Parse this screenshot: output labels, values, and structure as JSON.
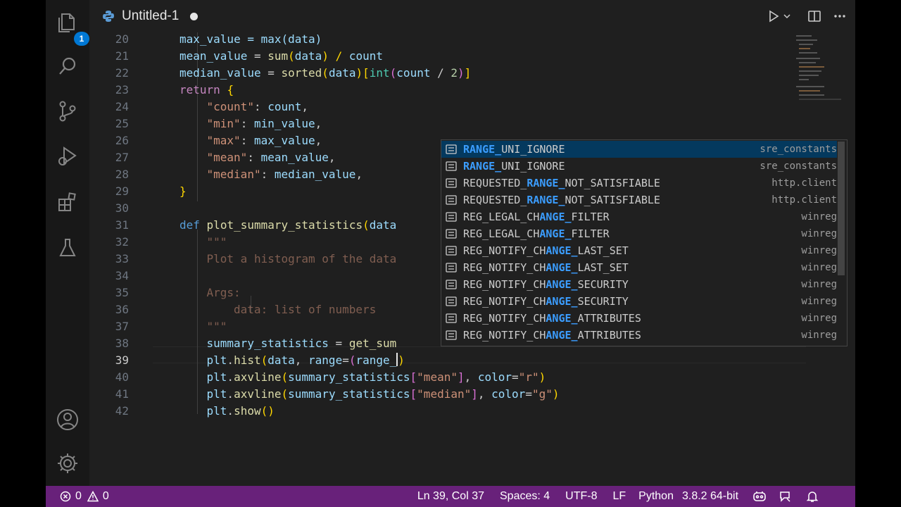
{
  "tab": {
    "filename": "Untitled-1"
  },
  "activity": {
    "explorer_badge": "1"
  },
  "editor": {
    "lines": [
      {
        "num": "20"
      },
      {
        "num": "21"
      },
      {
        "num": "22"
      },
      {
        "num": "23"
      },
      {
        "num": "24"
      },
      {
        "num": "25"
      },
      {
        "num": "26"
      },
      {
        "num": "27"
      },
      {
        "num": "28"
      },
      {
        "num": "29"
      },
      {
        "num": "30"
      },
      {
        "num": "31"
      },
      {
        "num": "32"
      },
      {
        "num": "33"
      },
      {
        "num": "34"
      },
      {
        "num": "35"
      },
      {
        "num": "36"
      },
      {
        "num": "37"
      },
      {
        "num": "38"
      },
      {
        "num": "39"
      },
      {
        "num": "40"
      },
      {
        "num": "41"
      },
      {
        "num": "42"
      }
    ],
    "code": {
      "l20": "max_value = max(data)",
      "l21": [
        "mean_value",
        " = ",
        "sum",
        "(",
        "data",
        ") / ",
        "count"
      ],
      "l22": [
        "median_value",
        " = ",
        "sorted",
        "(",
        "data",
        ")",
        "[",
        "int",
        "(",
        "count",
        " / ",
        "2",
        ")",
        "]"
      ],
      "l23": [
        "return",
        " ",
        "{"
      ],
      "l24": [
        "\"count\"",
        ": ",
        "count",
        ","
      ],
      "l25": [
        "\"min\"",
        ": ",
        "min_value",
        ","
      ],
      "l26": [
        "\"max\"",
        ": ",
        "max_value",
        ","
      ],
      "l27": [
        "\"mean\"",
        ": ",
        "mean_value",
        ","
      ],
      "l28": [
        "\"median\"",
        ": ",
        "median_value",
        ","
      ],
      "l29": [
        "}"
      ],
      "l31": [
        "def",
        " ",
        "plot_summary_statistics",
        "(",
        "data"
      ],
      "l32": [
        "\"\"\""
      ],
      "l33": [
        "Plot a histogram of the data"
      ],
      "l35": [
        "Args:"
      ],
      "l36": [
        "data: list of numbers"
      ],
      "l37": [
        "\"\"\""
      ],
      "l38": [
        "summary_statistics",
        " = ",
        "get_sum"
      ],
      "l39": [
        "plt",
        ".",
        "hist",
        "(",
        "data",
        ", ",
        "range",
        "=",
        "(",
        "range_",
        ")"
      ],
      "l40": [
        "plt",
        ".",
        "axvline",
        "(",
        "summary_statistics",
        "[",
        "\"mean\"",
        "]",
        ", ",
        "color",
        "=",
        "\"r\"",
        ")"
      ],
      "l41": [
        "plt",
        ".",
        "axvline",
        "(",
        "summary_statistics",
        "[",
        "\"median\"",
        "]",
        ", ",
        "color",
        "=",
        "\"g\"",
        ")"
      ],
      "l42": [
        "plt",
        ".",
        "show",
        "(",
        ")"
      ]
    }
  },
  "suggestions": [
    {
      "pre": "",
      "hl": "RANGE_",
      "post": "UNI_IGNORE",
      "detail": "sre_constants",
      "selected": true
    },
    {
      "pre": "",
      "hl": "RANGE_",
      "post": "UNI_IGNORE",
      "detail": "sre_constants"
    },
    {
      "pre": "REQUESTED_",
      "hl": "RANGE_",
      "post": "NOT_SATISFIABLE",
      "detail": "http.client"
    },
    {
      "pre": "REQUESTED_",
      "hl": "RANGE_",
      "post": "NOT_SATISFIABLE",
      "detail": "http.client"
    },
    {
      "pre": "REG_LEGAL_CH",
      "hl": "ANGE_",
      "post": "FILTER",
      "detail": "winreg"
    },
    {
      "pre": "REG_LEGAL_CH",
      "hl": "ANGE_",
      "post": "FILTER",
      "detail": "winreg"
    },
    {
      "pre": "REG_NOTIFY_CH",
      "hl": "ANGE_",
      "post": "LAST_SET",
      "detail": "winreg"
    },
    {
      "pre": "REG_NOTIFY_CH",
      "hl": "ANGE_",
      "post": "LAST_SET",
      "detail": "winreg"
    },
    {
      "pre": "REG_NOTIFY_CH",
      "hl": "ANGE_",
      "post": "SECURITY",
      "detail": "winreg"
    },
    {
      "pre": "REG_NOTIFY_CH",
      "hl": "ANGE_",
      "post": "SECURITY",
      "detail": "winreg"
    },
    {
      "pre": "REG_NOTIFY_CH",
      "hl": "ANGE_",
      "post": "ATTRIBUTES",
      "detail": "winreg"
    },
    {
      "pre": "REG_NOTIFY_CH",
      "hl": "ANGE_",
      "post": "ATTRIBUTES",
      "detail": "winreg"
    }
  ],
  "status": {
    "errors": "0",
    "warnings": "0",
    "position": "Ln 39, Col 37",
    "spaces": "Spaces: 4",
    "encoding": "UTF-8",
    "eol": "LF",
    "language": "Python",
    "interpreter": "3.8.2 64-bit"
  },
  "colors": {
    "statusbar": "#68217a",
    "accent": "#0078d4",
    "match_highlight": "#3b9dff"
  }
}
